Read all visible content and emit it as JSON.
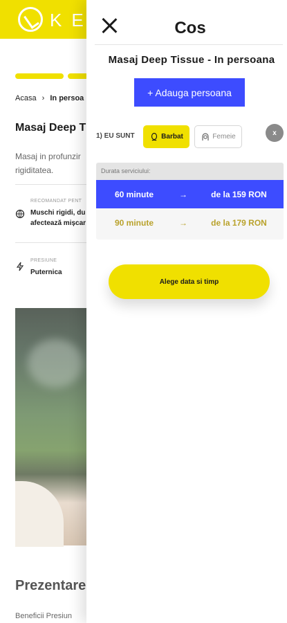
{
  "background_page": {
    "logo_text": "KE",
    "breadcrumb": {
      "home": "Acasa",
      "sep": "›",
      "current": "In persoa"
    },
    "title": "Masaj Deep T",
    "description": "Masaj in profunzir rigiditatea.",
    "recommended_label": "RECOMANDAT PENT",
    "recommended_value": "Muschi rigidi, du afectează mișcar",
    "pressure_label": "PRESIUNE",
    "pressure_value": "Puternica",
    "section_title": "Prezentare",
    "section_sub": "Beneficii Presiun"
  },
  "drawer": {
    "title": "Cos",
    "service_name": "Masaj Deep Tissue - In persoana",
    "add_person_label": "+ Adauga persoana",
    "person": {
      "iam_label": "1) EU SUNT",
      "male_label": "Barbat",
      "female_label": "Femeie",
      "remove_label": "x"
    },
    "durations": {
      "header": "Durata serviciului:",
      "options": [
        {
          "minutes": "60 minute",
          "arrow": "→",
          "price": "de la 159 RON"
        },
        {
          "minutes": "90 minute",
          "arrow": "→",
          "price": "de la 179 RON"
        }
      ],
      "selected_index": 0
    },
    "cta_label": "Alege data si timp"
  },
  "colors": {
    "brand_yellow": "#f0e000",
    "accent_blue": "#3d4cff",
    "muted_gold": "#b9a22b"
  }
}
